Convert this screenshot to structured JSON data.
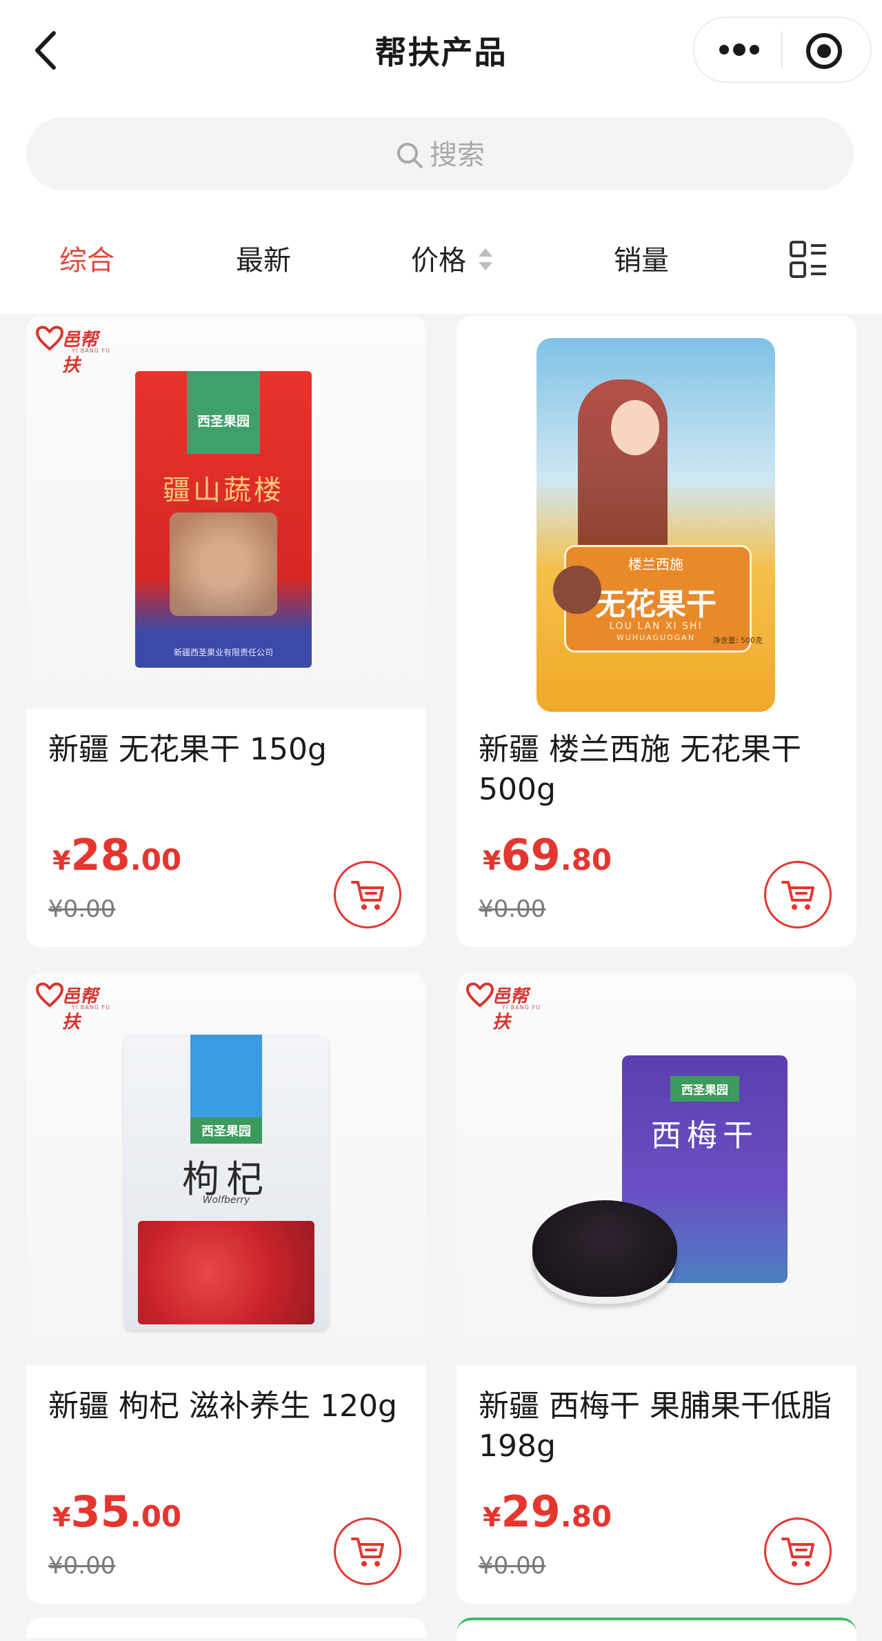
{
  "header": {
    "title": "帮扶产品",
    "back_icon": "chevron-left-icon",
    "more_icon": "more-dots-icon",
    "close_icon": "target-icon"
  },
  "search": {
    "placeholder": "搜索",
    "icon": "search-icon"
  },
  "sort_bar": {
    "items": [
      {
        "label": "综合",
        "active": true
      },
      {
        "label": "最新",
        "active": false
      },
      {
        "label": "价格",
        "active": false
      },
      {
        "label": "销量",
        "active": false
      }
    ],
    "view_toggle_icon": "list-grid-icon"
  },
  "badge": {
    "brand": "邑帮扶",
    "brand_en": "YI BANG FU"
  },
  "products": [
    {
      "name": "新疆 无花果干 150g",
      "price_currency": "¥",
      "price_int": "28",
      "price_dec": ".00",
      "old_price": "¥0.00",
      "pkg_brand": "西圣果园",
      "pkg_text": "疆山蔬楼",
      "pkg_footer": "新疆西圣果业有限责任公司"
    },
    {
      "name": "新疆 楼兰西施 无花果干 500g",
      "price_currency": "¥",
      "price_int": "69",
      "price_dec": ".80",
      "old_price": "¥0.00",
      "pkg_brand": "楼兰西施",
      "pkg_text": "无花果干",
      "pkg_sub": "LOU LAN XI SHI",
      "pkg_sub2": "WUHUAGUOGAN",
      "pkg_weight": "净含量: 500克"
    },
    {
      "name": "新疆 枸杞 滋补养生 120g",
      "price_currency": "¥",
      "price_int": "35",
      "price_dec": ".00",
      "old_price": "¥0.00",
      "pkg_brand": "西圣果园",
      "pkg_text": "枸杞",
      "pkg_sub": "Wolfberry"
    },
    {
      "name": "新疆 西梅干 果脯果干低脂 198g",
      "price_currency": "¥",
      "price_int": "29",
      "price_dec": ".80",
      "old_price": "¥0.00",
      "pkg_brand": "西圣果园",
      "pkg_text": "西梅干"
    }
  ],
  "colors": {
    "accent": "#e5352f",
    "active_tab": "#e2483d",
    "background": "#f4f4f4"
  }
}
